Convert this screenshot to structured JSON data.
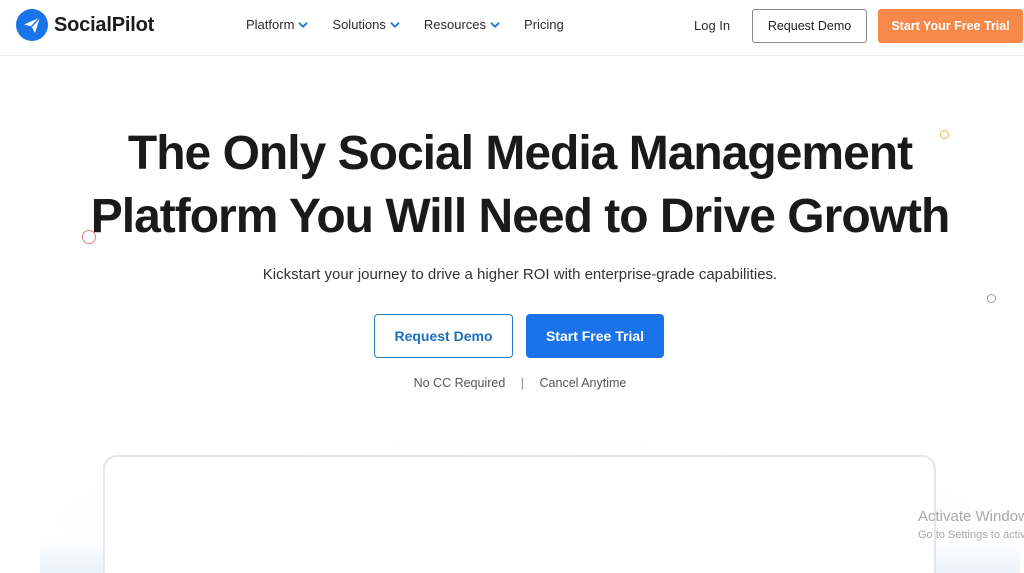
{
  "brand": {
    "name": "SocialPilot",
    "logo_icon": "paper-plane-icon",
    "logo_color": "#1a73e8"
  },
  "nav": {
    "items": [
      {
        "label": "Platform",
        "has_dropdown": true
      },
      {
        "label": "Solutions",
        "has_dropdown": true
      },
      {
        "label": "Resources",
        "has_dropdown": true
      },
      {
        "label": "Pricing",
        "has_dropdown": false
      }
    ],
    "login_label": "Log In",
    "request_demo_label": "Request Demo",
    "free_trial_label": "Start Your Free Trial"
  },
  "hero": {
    "title_line1": "The Only Social Media Management",
    "title_line2": "Platform You Will Need to Drive Growth",
    "subtitle": "Kickstart your journey to drive a higher ROI with enterprise-grade capabilities.",
    "request_demo_label": "Request Demo",
    "start_trial_label": "Start Free Trial",
    "note_1": "No CC Required",
    "note_separator": "|",
    "note_2": "Cancel Anytime"
  },
  "watermark": {
    "line1": "Activate Windows",
    "line2": "Go to Settings to activate Windows."
  },
  "colors": {
    "accent_blue": "#1a73e8",
    "accent_orange": "#f6894a",
    "text_dark": "#1a1a1a"
  }
}
